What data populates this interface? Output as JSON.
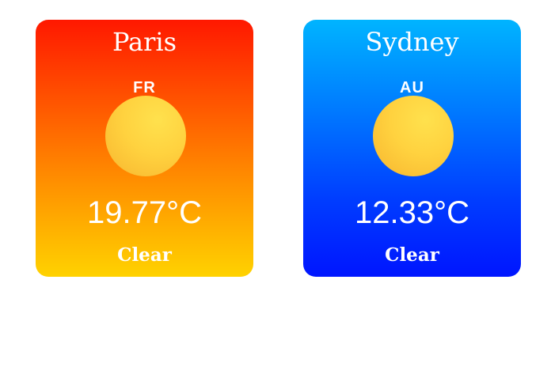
{
  "cards": [
    {
      "city": "Paris",
      "country": "FR",
      "icon": "sun-icon",
      "temperature": "19.77°C",
      "condition": "Clear",
      "gradient_top": "#ff1800",
      "gradient_bottom": "#ffd200"
    },
    {
      "city": "Sydney",
      "country": "AU",
      "icon": "sun-icon",
      "temperature": "12.33°C",
      "condition": "Clear",
      "gradient_top": "#00b4ff",
      "gradient_bottom": "#0015ff"
    }
  ]
}
